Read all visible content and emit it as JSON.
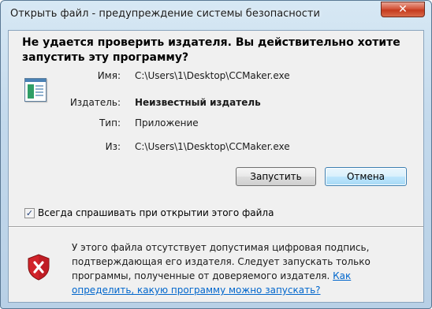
{
  "window": {
    "title": "Открыть файл - предупреждение системы безопасности",
    "close_label": "✕"
  },
  "question": "Не удается проверить издателя.  Вы действительно хотите запустить эту программу?",
  "details": {
    "name_label": "Имя:",
    "name_value": "C:\\Users\\1\\Desktop\\CCMaker.exe",
    "publisher_label": "Издатель:",
    "publisher_value": "Неизвестный издатель",
    "type_label": "Тип:",
    "type_value": "Приложение",
    "from_label": "Из:",
    "from_value": "C:\\Users\\1\\Desktop\\CCMaker.exe"
  },
  "buttons": {
    "run_label": "Запустить",
    "cancel_label": "Отмена"
  },
  "checkbox": {
    "label": "Всегда спрашивать при открытии этого файла",
    "checked": true,
    "check_glyph": "✓"
  },
  "warning": {
    "text": "У этого файла отсутствует допустимая цифровая подпись, подтверждающая его издателя. Следует запускать только программы, полученные от доверяемого издателя. ",
    "link_text": "Как определить, какую программу можно запускать?"
  },
  "icons": {
    "file": "application-file-icon",
    "shield": "security-shield-error-icon",
    "close": "close-icon"
  },
  "colors": {
    "link": "#0066cc",
    "close_button": "#c53a1e",
    "shield_red": "#d2232a"
  }
}
